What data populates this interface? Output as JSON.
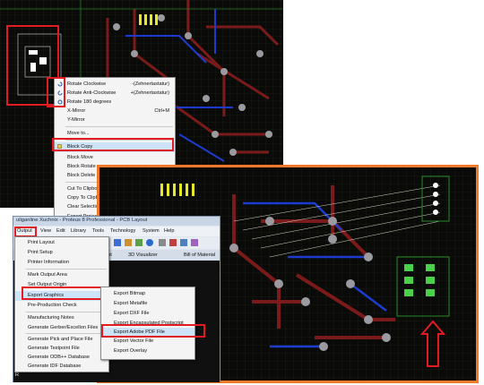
{
  "context_menu": {
    "items": [
      {
        "label": "Rotate Clockwise",
        "shortcut": "-(Zehnertastatur)",
        "icon": "rotate-cw-icon"
      },
      {
        "label": "Rotate Anti-Clockwise",
        "shortcut": "+(Zehnertastatur)",
        "icon": "rotate-ccw-icon"
      },
      {
        "label": "Rotate 180 degrees",
        "shortcut": "",
        "icon": "rotate-180-icon"
      },
      {
        "label": "X-Mirror",
        "shortcut": "Ctrl+M",
        "icon": ""
      },
      {
        "label": "Y-Mirror",
        "shortcut": "",
        "icon": ""
      },
      {
        "label": "Move to...",
        "shortcut": "",
        "icon": ""
      },
      {
        "label": "Block Copy",
        "shortcut": "",
        "icon": "block-copy-icon"
      },
      {
        "label": "Block Move",
        "shortcut": "",
        "icon": ""
      },
      {
        "label": "Block Rotate",
        "shortcut": "",
        "icon": ""
      },
      {
        "label": "Block Delete",
        "shortcut": "",
        "icon": ""
      },
      {
        "label": "Cut To Clipbo",
        "shortcut": "",
        "icon": ""
      },
      {
        "label": "Copy To Clipb",
        "shortcut": "",
        "icon": ""
      },
      {
        "label": "Clear Selectio",
        "shortcut": "",
        "icon": ""
      },
      {
        "label": "Export Project",
        "shortcut": "",
        "icon": ""
      }
    ]
  },
  "window": {
    "title": "uliganline Xuchnix - Proteus 8 Professional - PCB Layout",
    "menubar": [
      "Output",
      "View",
      "Edit",
      "Library",
      "Tools",
      "Technology",
      "System",
      "Help"
    ],
    "tabs": [
      "out",
      "3D Visualizer",
      "Bill of Material"
    ]
  },
  "output_menu": {
    "items": [
      "Print Layout",
      "Print Setup",
      "Printer Information",
      "Mark Output Area",
      "Set Output Origin",
      "Export Graphics",
      "Pre-Production Check",
      "Manufacturing Notes",
      "Generate Gerber/Excellon Files",
      "Generate Pick and Place File",
      "Generate Testpoint File",
      "Generate ODB++ Database",
      "Generate IDF Database"
    ]
  },
  "export_submenu": {
    "items": [
      "Export Bitmap",
      "Export Metafile",
      "Export DXF File",
      "Export Encapsulated Postscript",
      "Export Adobe PDF File",
      "Export Vector File",
      "Export Overlay"
    ]
  },
  "statusbar": {
    "letters": [
      "R",
      "R"
    ]
  },
  "colors": {
    "highlight_red": "#e21b22",
    "frame_orange": "#f07a2a",
    "menu_hover": "#cde3f7",
    "pcb_background": "#0a0a08"
  }
}
